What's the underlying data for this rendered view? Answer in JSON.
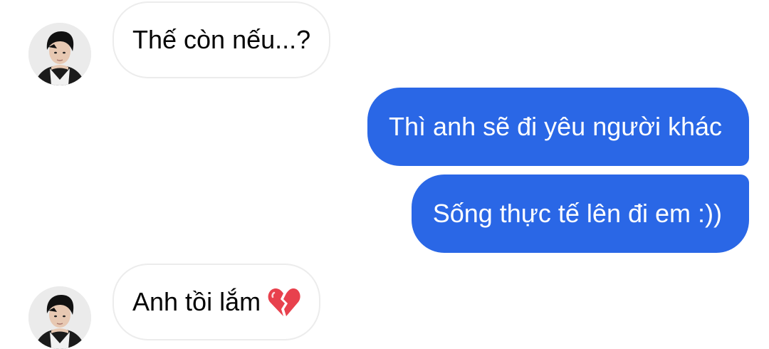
{
  "conversation": {
    "messages": [
      {
        "sender": "contact",
        "text": "Thế còn nếu...?"
      },
      {
        "sender": "me",
        "text": "Thì anh sẽ đi yêu người khác"
      },
      {
        "sender": "me",
        "text": "Sống thực tế lên đi em :))"
      },
      {
        "sender": "contact",
        "text": "Anh tồi lắm",
        "emoji": "broken-heart-icon"
      }
    ]
  },
  "colors": {
    "outgoing_bubble": "#2a67e6",
    "incoming_bubble_border": "#ececec",
    "incoming_text": "#050505",
    "outgoing_text": "#ffffff",
    "broken_heart": "#e8414d"
  }
}
